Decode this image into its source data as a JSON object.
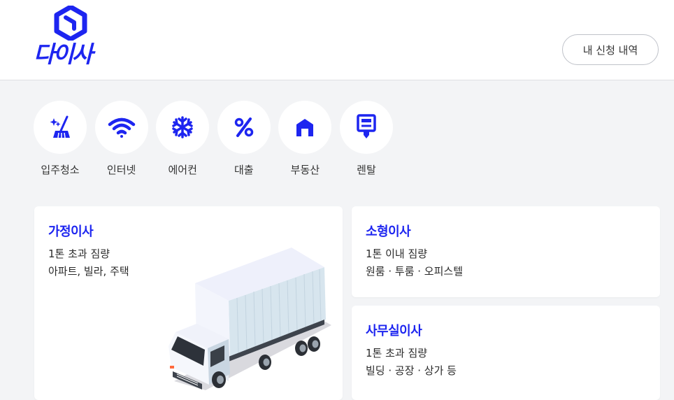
{
  "header": {
    "logo_text": "다이사",
    "history_button": "내 신청 내역"
  },
  "services": [
    {
      "label": "입주청소",
      "icon": "cleaning-icon"
    },
    {
      "label": "인터넷",
      "icon": "wifi-icon"
    },
    {
      "label": "에어컨",
      "icon": "snowflake-icon"
    },
    {
      "label": "대출",
      "icon": "percent-icon"
    },
    {
      "label": "부동산",
      "icon": "house-icon"
    },
    {
      "label": "렌탈",
      "icon": "rental-icon"
    }
  ],
  "cards": {
    "family": {
      "title": "가정이사",
      "line1": "1톤 초과 짐량",
      "line2": "아파트, 빌라, 주택"
    },
    "small": {
      "title": "소형이사",
      "line1": "1톤 이내 짐량",
      "line2": "원룸 · 투룸 · 오피스텔"
    },
    "office": {
      "title": "사무실이사",
      "line1": "1톤 초과 짐량",
      "line2": "빌딩 · 공장 · 상가 등"
    }
  },
  "colors": {
    "brand": "#1d25f0",
    "background": "#f3f4f6"
  }
}
